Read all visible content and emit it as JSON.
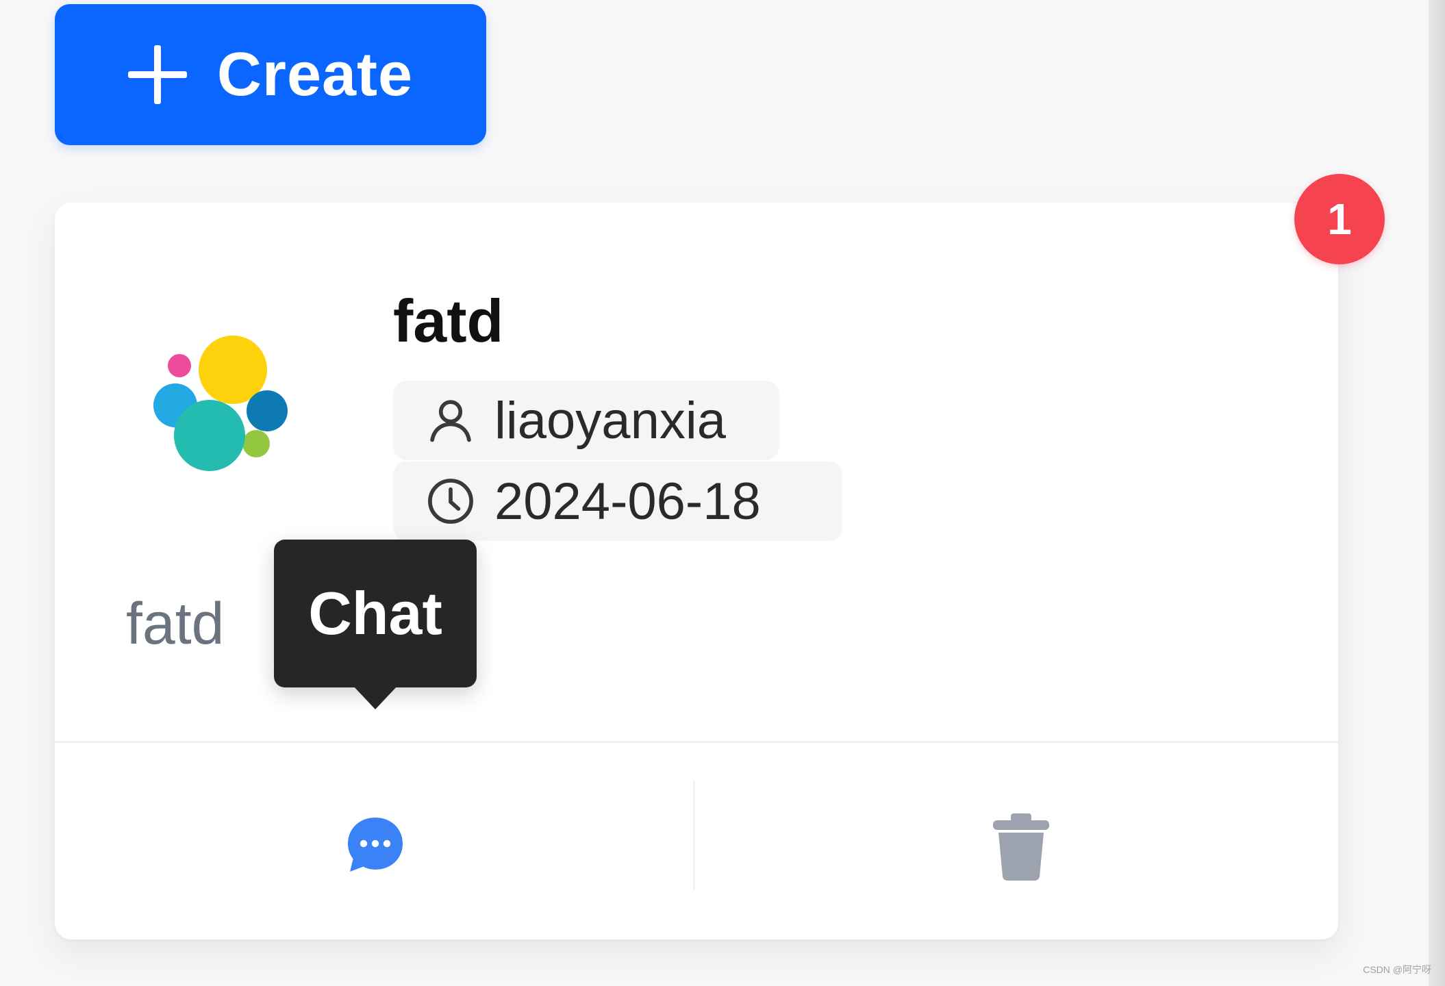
{
  "toolbar": {
    "create_label": "Create"
  },
  "card": {
    "title": "fatd",
    "owner": "liaoyanxia",
    "date": "2024-06-18",
    "description": "fatd",
    "notification_count": "1",
    "actions": {
      "chat_tooltip": "Chat"
    }
  },
  "icons": {
    "create": "plus-icon",
    "logo": "elastic-logo",
    "owner": "user-icon",
    "date": "clock-icon",
    "chat": "chat-bubble-icon",
    "delete": "trash-icon"
  },
  "colors": {
    "primary": "#0a66ff",
    "badge": "#f5434f",
    "tooltip_bg": "#262626",
    "chat_icon": "#3b82f6",
    "delete_icon": "#9ca3af"
  },
  "watermark": "CSDN @阿宁呀"
}
